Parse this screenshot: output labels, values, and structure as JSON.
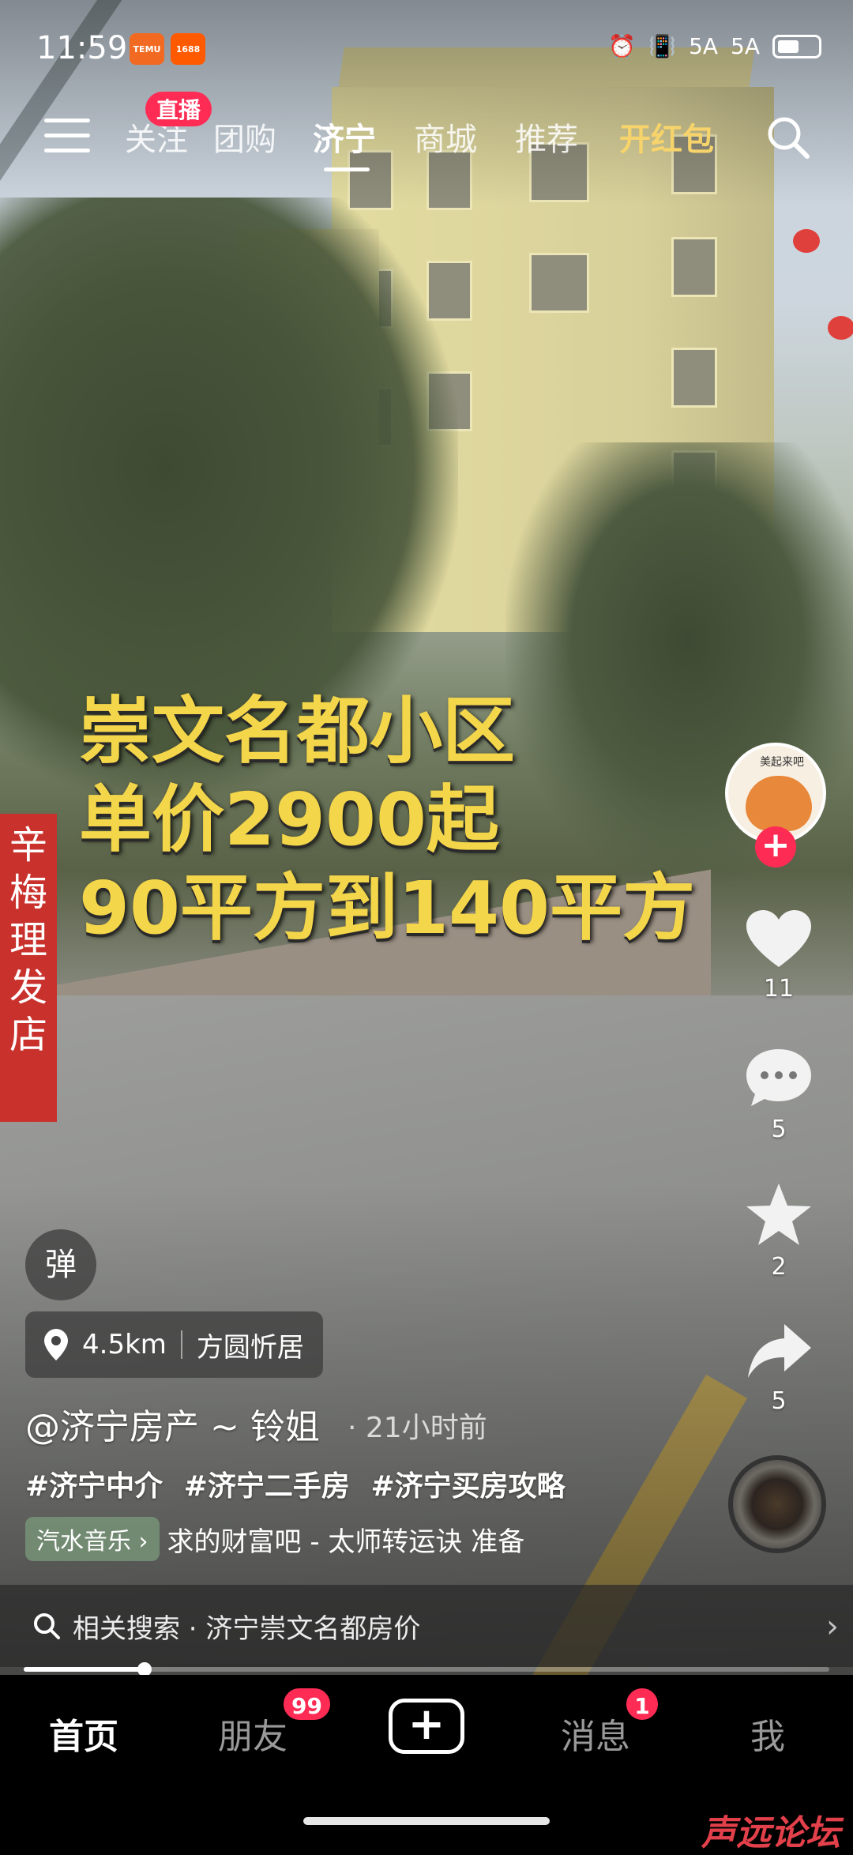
{
  "status_bar": {
    "time": "11:59",
    "apps": [
      {
        "name": "temu",
        "label": "TEMU",
        "color": "#f26a21"
      },
      {
        "name": "1688",
        "label": "1688",
        "color": "#ff5a00"
      }
    ],
    "signal_1": "5A",
    "signal_2": "5A"
  },
  "top_nav": {
    "live_badge": "直播",
    "tabs": [
      "关注",
      "团购",
      "济宁",
      "商城",
      "推荐",
      "开红包"
    ],
    "active_tab": "济宁"
  },
  "video": {
    "overlay_lines": [
      "崇文名都小区",
      "单价2900起",
      "90平方到140平方"
    ],
    "sign_text": "辛梅理发店"
  },
  "actions": {
    "likes": "11",
    "comments": "5",
    "favorites": "2",
    "shares": "5",
    "avatar_caption": "美起来吧"
  },
  "info": {
    "danmu_label": "弹",
    "distance": "4.5km",
    "place": "方圆忻居",
    "author": "@济宁房产 ~ 铃姐",
    "time_ago": "· 21小时前",
    "tags": [
      "#济宁中介",
      "#济宁二手房",
      "#济宁买房攻略"
    ],
    "music_chip": "汽水音乐 ›",
    "music_text": "求的财富吧 - 太师转运诀  准备"
  },
  "related": {
    "text": "相关搜索 · 济宁崇文名都房价",
    "chevron": "›"
  },
  "progress": {
    "fraction": 0.15
  },
  "tabbar": {
    "home": "首页",
    "friends": "朋友",
    "friends_badge": "99",
    "plus": "+",
    "messages": "消息",
    "messages_badge": "1",
    "me": "我"
  },
  "watermark": "声远论坛",
  "colors": {
    "accent": "#fe2c55",
    "overlay_text": "#f4d64b",
    "gold_tab": "#f7d46b"
  }
}
